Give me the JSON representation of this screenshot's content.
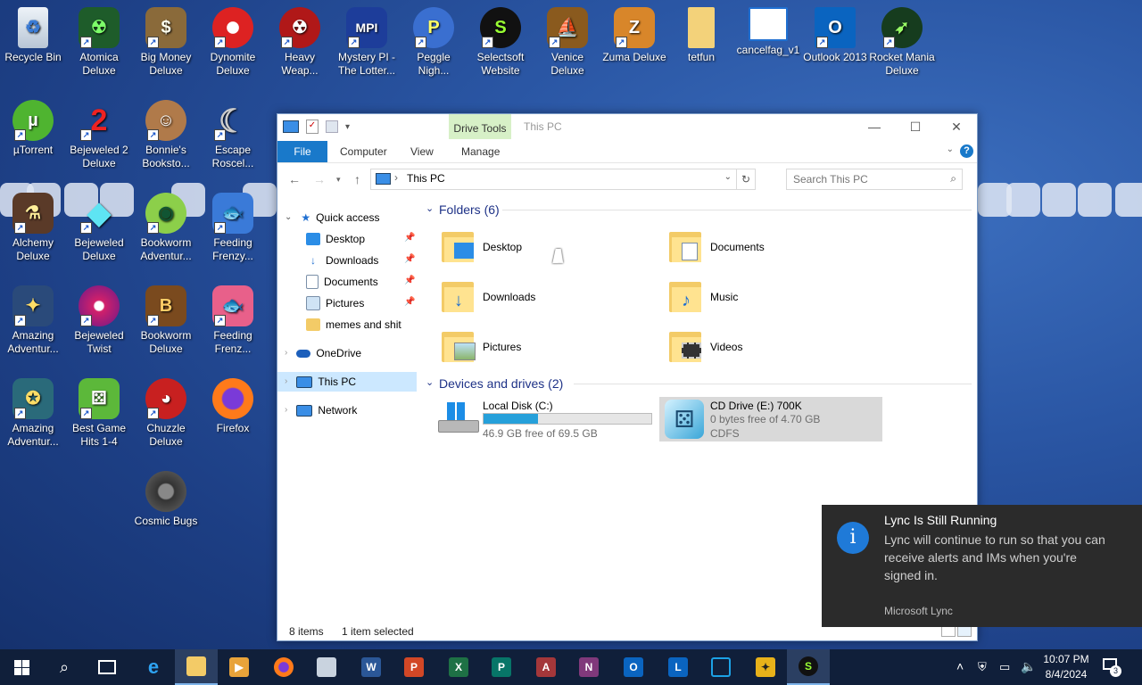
{
  "desktop_icons": [
    {
      "label": "Recycle Bin",
      "icon": "recycle-bin-icon"
    },
    {
      "label": "Atomica Deluxe",
      "icon": "atomica-icon"
    },
    {
      "label": "Big Money Deluxe",
      "icon": "big-money-icon"
    },
    {
      "label": "Dynomite Deluxe",
      "icon": "dynomite-icon"
    },
    {
      "label": "Heavy Weap...",
      "icon": "heavy-weapon-icon"
    },
    {
      "label": "Mystery PI - The Lotter...",
      "icon": "mystery-pi-icon"
    },
    {
      "label": "Peggle Nigh...",
      "icon": "peggle-icon"
    },
    {
      "label": "Selectsoft Website",
      "icon": "selectsoft-icon"
    },
    {
      "label": "Venice Deluxe",
      "icon": "venice-icon"
    },
    {
      "label": "Zuma Deluxe",
      "icon": "zuma-icon"
    },
    {
      "label": "tetfun",
      "icon": "folder-icon"
    },
    {
      "label": "cancelfag_v1",
      "icon": "document-icon"
    },
    {
      "label": "Outlook 2013",
      "icon": "outlook-icon"
    },
    {
      "label": "Rocket Mania Deluxe",
      "icon": "rocket-mania-icon"
    },
    {
      "label": "µTorrent",
      "icon": "utorrent-icon"
    },
    {
      "label": "Bejeweled 2 Deluxe",
      "icon": "bejeweled-2-icon"
    },
    {
      "label": "Bonnie's Booksto...",
      "icon": "bonnies-bookstore-icon"
    },
    {
      "label": "Escape Roscel...",
      "icon": "escape-rosecliff-icon"
    },
    {
      "label": "Alchemy Deluxe",
      "icon": "alchemy-icon"
    },
    {
      "label": "Bejeweled Deluxe",
      "icon": "bejeweled-icon"
    },
    {
      "label": "Bookworm Adventur...",
      "icon": "bookworm-adventures-icon"
    },
    {
      "label": "Feeding Frenzy...",
      "icon": "feeding-frenzy-icon"
    },
    {
      "label": "Amazing Adventur...",
      "icon": "amazing-adventures-icon"
    },
    {
      "label": "Bejeweled Twist",
      "icon": "bejeweled-twist-icon"
    },
    {
      "label": "Bookworm Deluxe",
      "icon": "bookworm-icon"
    },
    {
      "label": "Feeding Frenz...",
      "icon": "feeding-frenzy-2-icon"
    },
    {
      "label": "Amazing Adventur...",
      "icon": "amazing-adventures-2-icon"
    },
    {
      "label": "Best Game Hits 1-4",
      "icon": "best-game-hits-icon"
    },
    {
      "label": "Chuzzle Deluxe",
      "icon": "chuzzle-icon"
    },
    {
      "label": "Firefox",
      "icon": "firefox-icon"
    },
    {
      "label": "Cosmic Bugs",
      "icon": "cosmic-bugs-icon"
    }
  ],
  "explorer": {
    "window_title": "This PC",
    "ribbon_context": "Drive Tools",
    "tabs": {
      "file": "File",
      "computer": "Computer",
      "view": "View",
      "manage": "Manage"
    },
    "address": "This PC",
    "search_placeholder": "Search This PC",
    "nav": {
      "quick_access": "Quick access",
      "desktop": "Desktop",
      "downloads": "Downloads",
      "documents": "Documents",
      "pictures": "Pictures",
      "memes": "memes and shit",
      "onedrive": "OneDrive",
      "this_pc": "This PC",
      "network": "Network"
    },
    "folders_header": "Folders (6)",
    "folders": {
      "desktop": "Desktop",
      "documents": "Documents",
      "downloads": "Downloads",
      "music": "Music",
      "pictures": "Pictures",
      "videos": "Videos"
    },
    "devices_header": "Devices and drives (2)",
    "drives": {
      "c_name": "Local Disk (C:)",
      "c_free": "46.9 GB free of 69.5 GB",
      "c_used_fraction": 0.325,
      "e_name": "CD Drive (E:) 700K",
      "e_free": "0 bytes free of 4.70 GB",
      "e_fs": "CDFS"
    },
    "status": {
      "items": "8 items",
      "selected": "1 item selected"
    }
  },
  "toast": {
    "title": "Lync Is Still Running",
    "body": "Lync will continue to run so that you can receive alerts and IMs when you're signed in.",
    "source": "Microsoft Lync"
  },
  "taskbar": {
    "time": "10:07 PM",
    "date": "8/4/2024",
    "notification_count": "3"
  },
  "colors": {
    "accent": "#1979ca",
    "selection": "#cce8ff",
    "drive_bar": "#26a0da",
    "taskbar": "#101f3a"
  }
}
